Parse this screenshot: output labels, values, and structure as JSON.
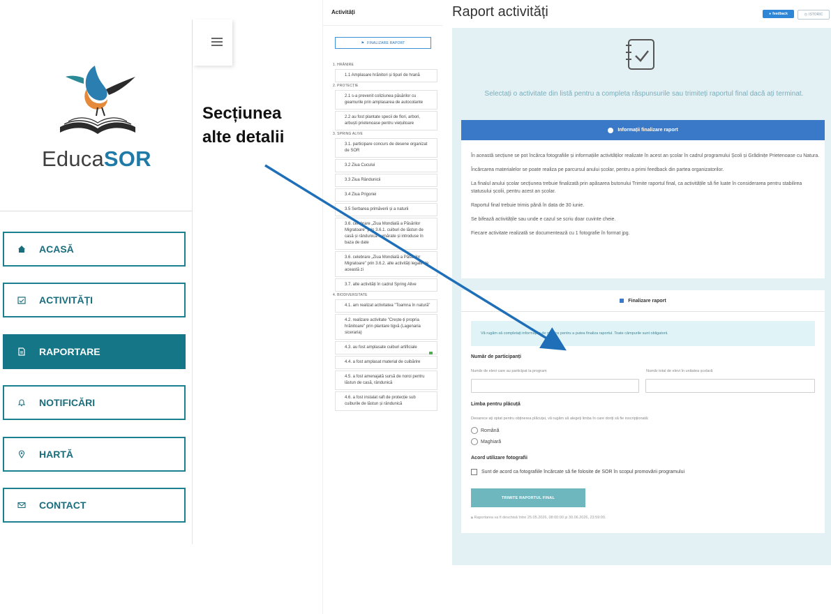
{
  "brand": {
    "name_plain": "Educa",
    "name_bold": "SOR"
  },
  "nav": {
    "items": [
      {
        "label": "ACASĂ",
        "icon": "home-icon"
      },
      {
        "label": "ACTIVITĂȚI",
        "icon": "calendar-icon"
      },
      {
        "label": "RAPORTARE",
        "icon": "document-icon",
        "active": true
      },
      {
        "label": "NOTIFICĂRI",
        "icon": "bell-icon"
      },
      {
        "label": "HARTĂ",
        "icon": "map-pin-icon"
      },
      {
        "label": "CONTACT",
        "icon": "envelope-icon"
      }
    ]
  },
  "annotation": {
    "line1": "Secțiunea",
    "line2": "alte detalii"
  },
  "activities": {
    "title": "Activități",
    "finalize_label": "FINALIZARE RAPORT",
    "groups": [
      {
        "category": "1. HRĂNIRE",
        "items": [
          "1.1 Amplasare hrănitori și tipuri de hrană"
        ]
      },
      {
        "category": "2. PROTECȚIE",
        "items": [
          "2.1 s-a prevenit coliziunea păsărilor cu geamurile prin amplasarea de autocolante",
          "2.2 au fost plantate specii de flori, arbori, arbuști prietenoase pentru viețuitoare"
        ]
      },
      {
        "category": "3. SPRING ALIVE",
        "items": [
          "3.1. participare concurs de desene organizat de SOR",
          "3.2 Ziua Cucului",
          "3.3 Ziua Rândunicii",
          "3.4 Ziua Prigoriei",
          "3.5 Serbarea primăverii și a naturii",
          "3.6. celebrare „Ziua Mondială a Păsărilor Migratoare\" prin 3.6.1. cuiburi de lăstun de casă și rândunică numărate și introduse în baza de date",
          "3.6. celebrare „Ziua Mondială a Păsărilor Migratoare\" prin 3.6.2. alte activități legate de această zi",
          "3.7. alte activități în cadrul Spring Alive"
        ]
      },
      {
        "category": "4. BIODIVERSITATE",
        "items": [
          "4.1. am realizat activitatea \"Toamna în natură\"",
          "4.2. realizare activitate \"Crește-ți propria hrănitoare\" prin plantare tigvă (Lagenaria siceraria)",
          "4.3. au fost amplasate cuiburi artificiale",
          "4.4. a fost amplasat material de cuibărire",
          "4.5. a fost amenajată sursă de noroi pentru lăstun de casă, rândunică",
          "4.6. a fost instalat raft de protecție sub cuiburile de lăstun și rândunică"
        ]
      }
    ]
  },
  "main": {
    "title": "Raport activități",
    "feedback_label": "feedback",
    "istoric_label": "ISTORIC",
    "select_prompt": "Selectați o activitate din listă pentru a completa răspunsurile sau trimiteți raportul final dacă ați terminat.",
    "info": {
      "heading": "Informații finalizare raport",
      "paragraphs": [
        "În această secțiune se pot încărca fotografiile și informațiile activităților realizate în acest an școlar în cadrul programului Școli și Grădinițe Prietenoase cu Natura.",
        "Încărcarea materialelor se poate realiza pe parcursul anului școlar, pentru a primi feedback din partea organizatorilor.",
        "La finalul anului școlar secțiunea trebuie finalizată prin apăsarea butonului Trimite raportul final, ca activitățile să fie luate în considerarea pentru stabilirea statusului școlii, pentru acest an școlar.",
        "Raportul final trebuie trimis până în data de 30 iunie.",
        "Se bifează activitățile sau unde e cazul se scriu doar cuvinte cheie.",
        "Fiecare activitate realizată se documentează cu 1 fotografie în format jpg."
      ]
    },
    "final": {
      "heading": "Finalizare raport",
      "alert": "Vă rugăm să completați informațiile de mai jos pentru a putea finaliza raportul. Toate câmpurile sunt obligatorii.",
      "participants_label": "Număr de participanți",
      "participants_sub1": "Număr de elevi care au participat la program",
      "participants_sub2": "Număr total de elevi în unitatea școlară",
      "language_label": "Limba pentru plăcuță",
      "language_sub": "Deoarece ați optat pentru obținerea plăcuței, vă rugăm să alegeți limba în care doriți să fie inscripționată:",
      "language_options": [
        "Română",
        "Maghiară"
      ],
      "photos_label": "Acord utilizare fotografii",
      "photos_check": "Sunt de acord ca fotografiile încărcate să fie folosite de SOR în scopul promovării programului",
      "submit_label": "TRIMITE RAPORTUL FINAL",
      "note": "Raportarea va fi deschisă între 25.05.2026, 08:00:00 și 30.06.2026, 23:59:00."
    }
  },
  "colors": {
    "teal": "#147686",
    "blue": "#3a78c8",
    "panel_bg": "#e3f0f4",
    "arrow": "#1f6fb8"
  }
}
